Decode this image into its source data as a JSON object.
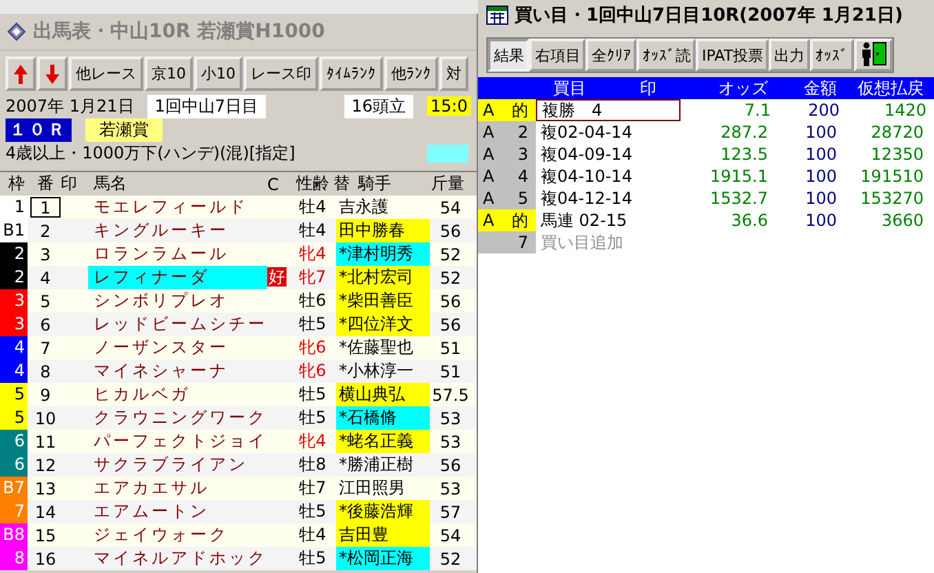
{
  "left_window": {
    "title": "出馬表・中山10R 若瀬賞H1000",
    "toolbar": [
      "他レース",
      "京10",
      "小10",
      "レース印",
      "ﾀｲﾑﾗﾝｸ",
      "他ﾗﾝｸ",
      "対"
    ],
    "date": "2007年 1月21日",
    "meeting": "1回中山7日目",
    "runners": "16頭立",
    "time": "15:0",
    "race_no": "１０Ｒ",
    "race_name": "若瀬賞",
    "conditions": "4歳以上・1000万下(ハンデ)(混)[指定]",
    "columns": [
      "枠",
      "番",
      "印",
      "馬名",
      "C",
      "性齢",
      "替",
      "騎手",
      "斤量"
    ],
    "rows": [
      {
        "frame": {
          "label": "1",
          "color": "#ffffff"
        },
        "number": "1",
        "selected": true,
        "name": "モエレフィールド",
        "highlighted": false,
        "sex_age": "牡4",
        "female": false,
        "jockey": {
          "name": "吉永護"
        },
        "weight": "54"
      },
      {
        "frame": {
          "label": "B1",
          "color": "#ffffff"
        },
        "number": "2",
        "selected": false,
        "name": "キングルーキー",
        "highlighted": false,
        "sex_age": "牡4",
        "female": false,
        "jockey": {
          "name": "田中勝春",
          "color": "#ffff00"
        },
        "weight": "56"
      },
      {
        "frame": {
          "label": "2",
          "color": "#000000"
        },
        "number": "3",
        "selected": false,
        "name": "ロランラムール",
        "highlighted": false,
        "sex_age": "牝4",
        "female": true,
        "jockey": {
          "name": "*津村明秀",
          "color": "#00ffff"
        },
        "weight": "52"
      },
      {
        "frame": {
          "label": "2",
          "color": "#000000"
        },
        "number": "4",
        "selected": false,
        "name": "レフィナーダ",
        "highlighted": true,
        "badge": "好",
        "sex_age": "牝7",
        "female": true,
        "jockey": {
          "name": "*北村宏司",
          "color": "#ffff00"
        },
        "weight": "52"
      },
      {
        "frame": {
          "label": "3",
          "color": "#ff0000"
        },
        "number": "5",
        "selected": false,
        "name": "シンボリプレオ",
        "highlighted": false,
        "sex_age": "牡6",
        "female": false,
        "jockey": {
          "name": "*柴田善臣",
          "color": "#ffff00"
        },
        "weight": "56"
      },
      {
        "frame": {
          "label": "3",
          "color": "#ff0000"
        },
        "number": "6",
        "selected": false,
        "name": "レッドビームシチー",
        "highlighted": false,
        "sex_age": "牡5",
        "female": false,
        "jockey": {
          "name": "*四位洋文",
          "color": "#ffff00"
        },
        "weight": "56"
      },
      {
        "frame": {
          "label": "4",
          "color": "#0000ff"
        },
        "number": "7",
        "selected": false,
        "name": "ノーザンスター",
        "highlighted": false,
        "sex_age": "牝6",
        "female": true,
        "jockey": {
          "name": "*佐藤聖也"
        },
        "weight": "51"
      },
      {
        "frame": {
          "label": "4",
          "color": "#0000ff"
        },
        "number": "8",
        "selected": false,
        "name": "マイネシャーナ",
        "highlighted": false,
        "sex_age": "牝6",
        "female": true,
        "jockey": {
          "name": "*小林淳一"
        },
        "weight": "51"
      },
      {
        "frame": {
          "label": "5",
          "color": "#ffff00"
        },
        "number": "9",
        "selected": false,
        "name": "ヒカルベガ",
        "highlighted": false,
        "sex_age": "牡5",
        "female": false,
        "jockey": {
          "name": "横山典弘",
          "color": "#ffff00"
        },
        "weight": "57.5"
      },
      {
        "frame": {
          "label": "5",
          "color": "#ffff00"
        },
        "number": "10",
        "selected": false,
        "name": "クラウニングワーク",
        "highlighted": false,
        "sex_age": "牡5",
        "female": false,
        "jockey": {
          "name": "*石橋脩",
          "color": "#00ffff"
        },
        "weight": "53"
      },
      {
        "frame": {
          "label": "6",
          "color": "#008080"
        },
        "number": "11",
        "selected": false,
        "name": "パーフェクトジョイ",
        "highlighted": false,
        "sex_age": "牝4",
        "female": true,
        "jockey": {
          "name": "*蛯名正義",
          "color": "#ffff00"
        },
        "weight": "53"
      },
      {
        "frame": {
          "label": "6",
          "color": "#008080"
        },
        "number": "12",
        "selected": false,
        "name": "サクラブライアン",
        "highlighted": false,
        "sex_age": "牡8",
        "female": false,
        "jockey": {
          "name": "*勝浦正樹"
        },
        "weight": "56"
      },
      {
        "frame": {
          "label": "B7",
          "color": "#ff8000"
        },
        "number": "13",
        "selected": false,
        "name": "エアカエサル",
        "highlighted": false,
        "sex_age": "牡7",
        "female": false,
        "jockey": {
          "name": "江田照男"
        },
        "weight": "53"
      },
      {
        "frame": {
          "label": "7",
          "color": "#ff8000"
        },
        "number": "14",
        "selected": false,
        "name": "エアムートン",
        "highlighted": false,
        "sex_age": "牡5",
        "female": false,
        "jockey": {
          "name": "*後藤浩輝",
          "color": "#ffff00"
        },
        "weight": "57"
      },
      {
        "frame": {
          "label": "B8",
          "color": "#ff00ff"
        },
        "number": "15",
        "selected": false,
        "name": "ジェイウォーク",
        "highlighted": false,
        "sex_age": "牡4",
        "female": false,
        "jockey": {
          "name": "吉田豊",
          "color": "#ffff00"
        },
        "weight": "54"
      },
      {
        "frame": {
          "label": "8",
          "color": "#ff00ff"
        },
        "number": "16",
        "selected": false,
        "name": "マイネルアドホック",
        "highlighted": false,
        "sex_age": "牡5",
        "female": false,
        "jockey": {
          "name": "*松岡正海",
          "color": "#00ffff"
        },
        "weight": "52"
      }
    ]
  },
  "right_window": {
    "title": "買い目・1回中山7日目10R(2007年 1月21日)",
    "toolbar": [
      {
        "label": "結果",
        "selected": true
      },
      {
        "label": "右項目",
        "selected": false
      },
      {
        "label": "全ｸﾘｱ",
        "selected": false
      },
      {
        "label": "ｵｯｽﾞ読",
        "selected": false
      },
      {
        "label": "IPAT投票",
        "selected": false
      },
      {
        "label": "出力",
        "selected": false
      },
      {
        "label": "ｵｯｽﾞ",
        "selected": false
      }
    ],
    "columns": [
      "買目",
      "印",
      "オッズ",
      "金額",
      "仮想払戻"
    ],
    "bets": [
      {
        "kind": "bet",
        "group": "A",
        "index": "的",
        "hit": true,
        "selected": true,
        "ticket": "複勝　4",
        "odds": "7.1",
        "amount": "200",
        "payout": "1420"
      },
      {
        "kind": "bet",
        "group": "A",
        "index": "2",
        "hit": false,
        "selected": false,
        "ticket": "複02-04-14",
        "odds": "287.2",
        "amount": "100",
        "payout": "28720"
      },
      {
        "kind": "bet",
        "group": "A",
        "index": "3",
        "hit": false,
        "selected": false,
        "ticket": "複04-09-14",
        "odds": "123.5",
        "amount": "100",
        "payout": "12350"
      },
      {
        "kind": "bet",
        "group": "A",
        "index": "4",
        "hit": false,
        "selected": false,
        "ticket": "複04-10-14",
        "odds": "1915.1",
        "amount": "100",
        "payout": "191510"
      },
      {
        "kind": "bet",
        "group": "A",
        "index": "5",
        "hit": false,
        "selected": false,
        "ticket": "複04-12-14",
        "odds": "1532.7",
        "amount": "100",
        "payout": "153270"
      },
      {
        "kind": "bet",
        "group": "A",
        "index": "的",
        "hit": true,
        "selected": false,
        "ticket": "馬連 02-15",
        "odds": "36.6",
        "amount": "100",
        "payout": "3660"
      },
      {
        "kind": "add",
        "index": "7",
        "ticket": "買い目追加"
      }
    ]
  }
}
